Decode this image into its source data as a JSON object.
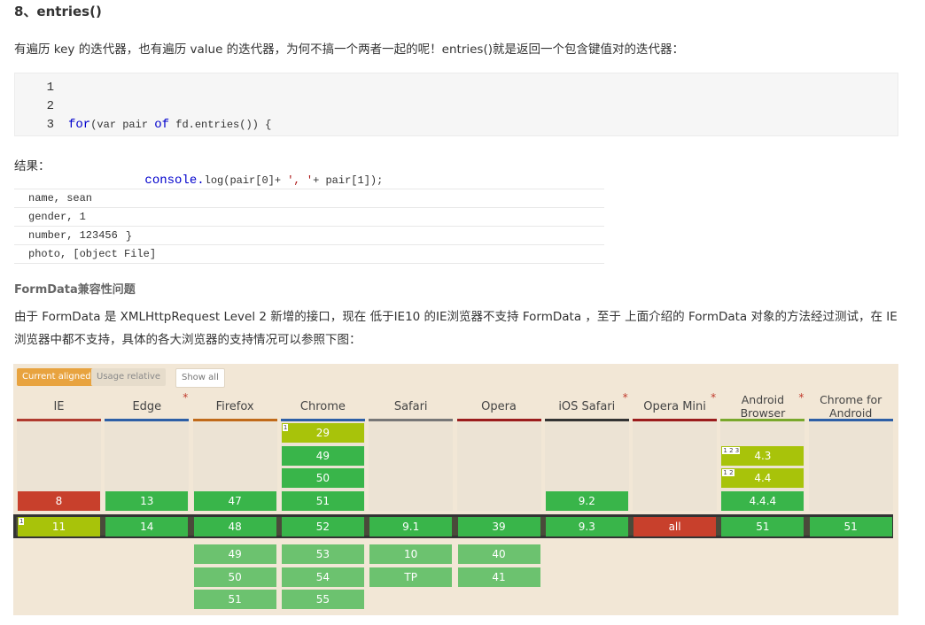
{
  "heading": "8、entries()",
  "intro": "有遍历 key 的迭代器，也有遍历 value 的迭代器，为何不搞一个两者一起的呢！entries()就是返回一个包含键值对的迭代器：",
  "code": {
    "line_numbers": [
      "1",
      "2",
      "3"
    ],
    "line1_kw1": "for",
    "line1_rest": "(var pair ",
    "line1_kw2": "of",
    "line1_rest2": " fd.entries()) {",
    "line2_kw": "console.",
    "line2_rest": "log(pair[0]+ ",
    "line2_str": "', '",
    "line2_rest2": "+ pair[1]);",
    "line3": "}"
  },
  "result_label": "结果：",
  "results": [
    "name, sean",
    "gender, 1",
    "number, 123456",
    "photo, [object File]"
  ],
  "compat_heading": "FormData兼容性问题",
  "compat_text": "由于 FormData 是 XMLHttpRequest Level 2 新增的接口，现在 低于IE10 的IE浏览器不支持 FormData ，至于 上面介绍的 FormData 对象的方法经过测试，在 IE 浏览器中都不支持，具体的各大浏览器的支持情况可以参照下图：",
  "caniuse": {
    "toggle_current": "Current aligned",
    "toggle_usage": "Usage relative",
    "show_all": "Show all",
    "browsers": [
      {
        "name": "IE",
        "bar": "#b03a2e",
        "star": false,
        "past": [
          "8"
        ],
        "current": "11",
        "current_type": "y",
        "current_tag": "1",
        "future": []
      },
      {
        "name": "Edge",
        "bar": "#2d5fa6",
        "star": true,
        "past": [
          "13"
        ],
        "current": "14",
        "current_type": "g",
        "future": []
      },
      {
        "name": "Firefox",
        "bar": "#c06a1a",
        "star": false,
        "past": [
          "47"
        ],
        "current": "48",
        "current_type": "g",
        "future": [
          "49",
          "50",
          "51"
        ]
      },
      {
        "name": "Chrome",
        "bar": "#2d5fa6",
        "star": false,
        "past": [
          "29",
          "49",
          "50",
          "51"
        ],
        "past_types": [
          "y",
          "g",
          "g",
          "g"
        ],
        "past_tags": [
          "1",
          "",
          "",
          ""
        ],
        "current": "52",
        "current_type": "g",
        "future": [
          "53",
          "54",
          "55"
        ]
      },
      {
        "name": "Safari",
        "bar": "#777777",
        "star": false,
        "past": [],
        "current": "9.1",
        "current_type": "g",
        "future": [
          "10",
          "TP"
        ]
      },
      {
        "name": "Opera",
        "bar": "#9b1c1c",
        "star": false,
        "past": [],
        "current": "39",
        "current_type": "g",
        "future": [
          "40",
          "41"
        ]
      },
      {
        "name": "iOS Safari",
        "bar": "#333333",
        "star": true,
        "past": [
          "9.2"
        ],
        "current": "9.3",
        "current_type": "g",
        "future": []
      },
      {
        "name": "Opera Mini",
        "bar": "#9b1c1c",
        "star": true,
        "past": [],
        "current": "all",
        "current_type": "r",
        "future": []
      },
      {
        "name": "Android Browser",
        "bar": "#79a82c",
        "star": true,
        "past": [
          "4.3",
          "4.4",
          "4.4.4"
        ],
        "past_types": [
          "y",
          "y",
          "g"
        ],
        "past_tags": [
          "1 2 3",
          "1 2",
          ""
        ],
        "current": "51",
        "current_type": "g",
        "future": []
      },
      {
        "name": "Chrome for Android",
        "bar": "#2d5fa6",
        "star": false,
        "past": [],
        "current": "51",
        "current_type": "g",
        "future": []
      }
    ]
  }
}
